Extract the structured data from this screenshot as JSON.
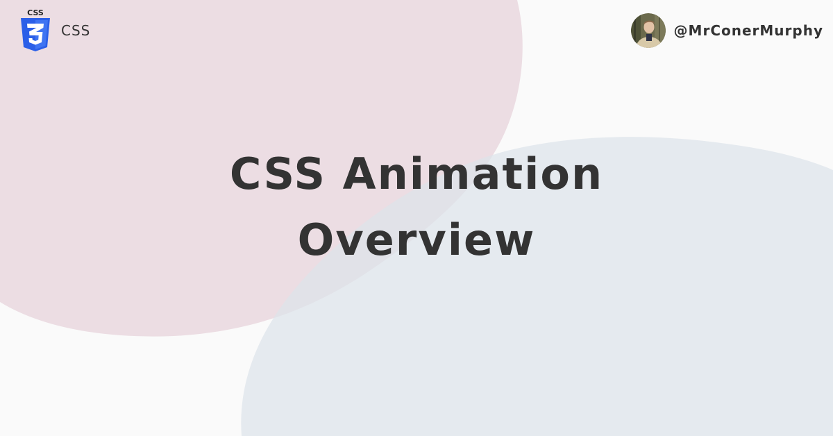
{
  "topic": {
    "label": "CSS",
    "badge_text": "CSS",
    "icon": "css3-logo-icon",
    "icon_color": "#2b5fe8"
  },
  "author": {
    "handle": "@MrConerMurphy",
    "avatar": "author-avatar-photo"
  },
  "title": {
    "line1": "CSS Animation",
    "line2": "Overview"
  },
  "colors": {
    "background": "#fafafa",
    "pink_blob": "#ecdde3",
    "blue_blob": "#dde3ea",
    "text": "#333333"
  }
}
